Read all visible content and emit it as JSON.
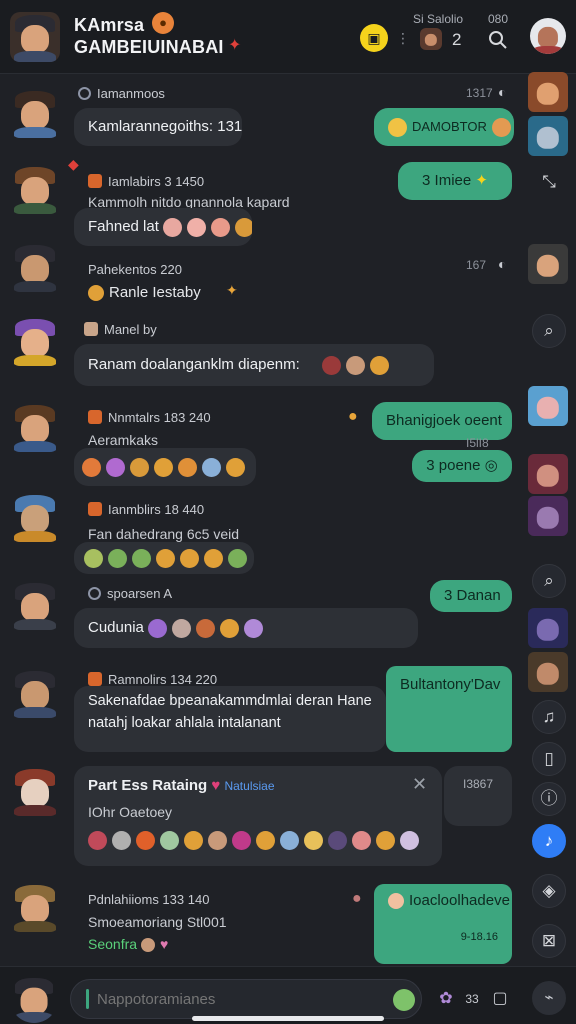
{
  "header": {
    "title_line1": "KAmrsa",
    "title_line2": "GAMBEIUINABAI",
    "status": "Si Salolio",
    "time": "080",
    "count": "2"
  },
  "messages": [
    {
      "name": "Iamanmoos",
      "text": "Kamlarannegoiths: 131",
      "time": "1317",
      "out": "DAMOBTOR"
    },
    {
      "name": "Iamlabirs 3 1450",
      "line": "Kammolh nitdo gnannola kapard",
      "text": "Fahned lat",
      "out": "3 Imiee"
    },
    {
      "name": "Pahekentos 220",
      "text": "Ranle Iestaby",
      "time": "167"
    },
    {
      "name": "Manel by",
      "text": "Ranam doalanganklm diapenm:"
    },
    {
      "name": "Nnmtalrs 183 240",
      "line": "Aeramkaks",
      "out": "Bhanigjoek oeent",
      "time": "I5lI8",
      "out2": "3 poene"
    },
    {
      "name": "Ianmblirs 18 440",
      "line": "Fan dahedrang 6c5 veid"
    },
    {
      "name": "spoarsen A",
      "text": "Cudunia",
      "out": "3 Danan"
    },
    {
      "name": "Ramnolirs 134 220",
      "line": "Sakenafdae bpeanakammdmlai deran Hane",
      "line2": "natahj loakar ahlala intalanant",
      "out": "Bultantony'Dav"
    },
    {
      "name": "Part Ess Rataing",
      "tag": "Natulsiae",
      "line": "IOhr Oaetoey",
      "time": "I3867"
    },
    {
      "name": "Pdnlahiioms 133 140",
      "line": "Smoeamoriang Stl001",
      "line2": "Seonfra",
      "out": "Ioacloolhadeve",
      "time": "9-18.16"
    }
  ],
  "composer": {
    "placeholder": "Nappotoramianes",
    "count": "33"
  },
  "colors": {
    "background": "#1f2126",
    "bubble_in": "#2d3036",
    "bubble_out": "#3da67f",
    "accent_blue": "#2f7df6"
  }
}
